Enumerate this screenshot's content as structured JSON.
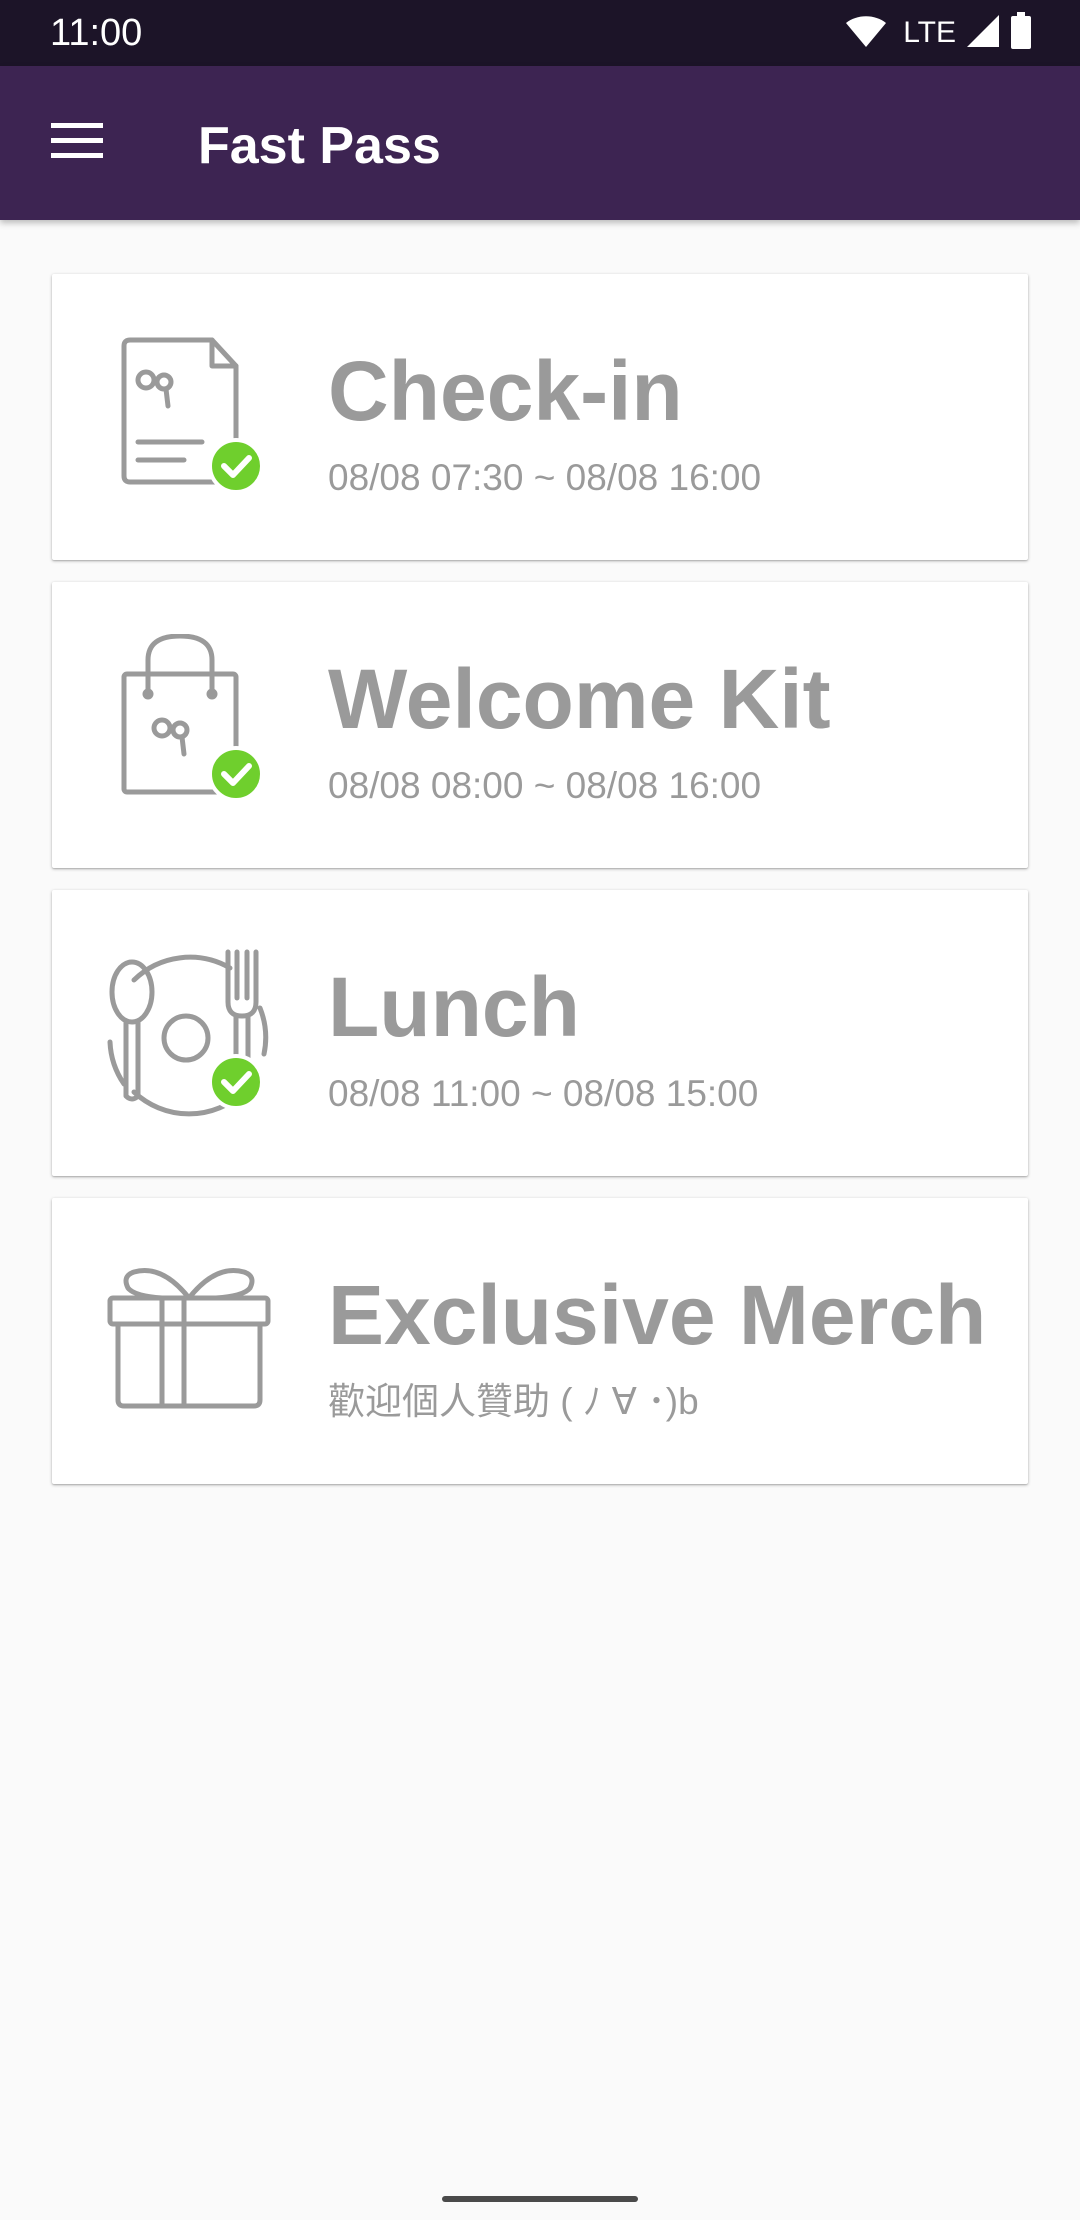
{
  "status_bar": {
    "time": "11:00",
    "network": "LTE",
    "icons": [
      "wifi-icon",
      "signal-icon",
      "battery-icon"
    ]
  },
  "app_bar": {
    "title": "Fast Pass",
    "menu_icon": "hamburger-menu-icon",
    "background_color": "#3d2452"
  },
  "cards": [
    {
      "title": "Check-in",
      "subtitle": "08/08 07:30 ~ 08/08 16:00",
      "icon": "document-check-icon",
      "completed": true
    },
    {
      "title": "Welcome Kit",
      "subtitle": "08/08 08:00 ~ 08/08 16:00",
      "icon": "shopping-bag-icon",
      "completed": true
    },
    {
      "title": "Lunch",
      "subtitle": "08/08 11:00 ~ 08/08 15:00",
      "icon": "plate-spoon-fork-icon",
      "completed": true
    },
    {
      "title": "Exclusive Merch",
      "subtitle": "歡迎個人贊助 ( ﾉ ∀ ･)b",
      "icon": "gift-box-icon",
      "completed": false
    }
  ],
  "colors": {
    "check_badge": "#6fcf2d",
    "icon_gray": "#9a9a9a",
    "status_bar": "#1c1428"
  }
}
